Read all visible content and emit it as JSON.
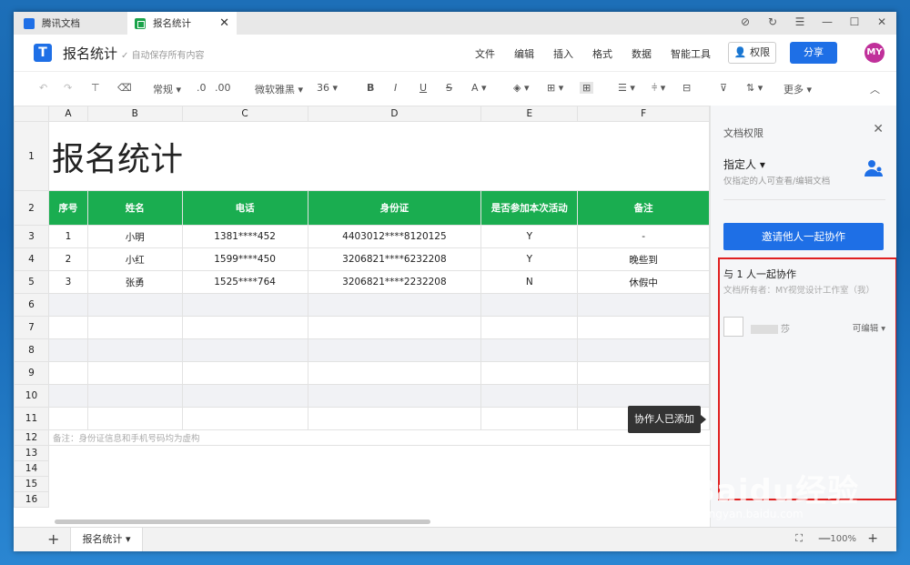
{
  "titlebar": {
    "tab1": "腾讯文档",
    "tab2": "报名统计",
    "tab_close": "✕",
    "controls": [
      "⊘",
      "↻",
      "☰",
      "—",
      "☐",
      "✕"
    ]
  },
  "header": {
    "logo": "T",
    "title": "报名统计",
    "autosave": "自动保存所有内容",
    "menu": [
      "文件",
      "编辑",
      "插入",
      "格式",
      "数据",
      "智能工具"
    ],
    "permission": "权限",
    "share": "分享",
    "avatar": "MY"
  },
  "toolbar": {
    "undo": "↶",
    "redo": "↷",
    "format_painter": "⊤",
    "clear": "⌫",
    "number_format": "常规 ▾",
    "dec_dec": ".0",
    "dec_inc": ".00",
    "font": "微软雅黑 ▾",
    "size": "36 ▾",
    "bold": "B",
    "italic": "I",
    "underline": "U",
    "strike": "S",
    "font_color": "A ▾",
    "fill": "◈ ▾",
    "border": "⊞ ▾",
    "merge": "⊞",
    "align": "☰ ▾",
    "valign": "⫩ ▾",
    "wrap": "⊟",
    "filter": "⊽",
    "sort": "⇅ ▾",
    "more": "更多 ▾",
    "collapse": "︿"
  },
  "sheet": {
    "columns": [
      "A",
      "B",
      "C",
      "D",
      "E",
      "F"
    ],
    "title": "报名统计",
    "headers": [
      "序号",
      "姓名",
      "电话",
      "身份证",
      "是否参加本次活动",
      "备注"
    ],
    "rows": [
      [
        "1",
        "小明",
        "1381****452",
        "4403012****8120125",
        "Y",
        "-"
      ],
      [
        "2",
        "小红",
        "1599****450",
        "3206821****6232208",
        "Y",
        "晚些到"
      ],
      [
        "3",
        "张勇",
        "1525****764",
        "3206821****2232208",
        "N",
        "休假中"
      ]
    ],
    "row_numbers": [
      "1",
      "2",
      "3",
      "4",
      "5",
      "6",
      "7",
      "8",
      "9",
      "10",
      "11",
      "12",
      "13",
      "14",
      "15",
      "16"
    ],
    "note": "备注：身份证信息和手机号码均为虚构"
  },
  "tooltip": "协作人已添加",
  "panel": {
    "title": "文档权限",
    "close": "✕",
    "designee": "指定人 ▾",
    "designee_desc": "仅指定的人可查看/编辑文档",
    "invite": "邀请他人一起协作",
    "collab": "与 1 人一起协作",
    "owner": "文档所有者：MY视觉设计工作室（我）",
    "user_name_suffix": "莎",
    "user_right": "可编辑 ▾"
  },
  "bottombar": {
    "add": "+",
    "sheet_tab": "报名统计 ▾",
    "zoom": "100%",
    "zoom_in": "+",
    "zoom_out": "—",
    "fit": "⛶"
  },
  "watermark": {
    "text": "Baidu经验",
    "url": "jingyan.baidu.com"
  },
  "colors": {
    "accent": "#1e6fe6",
    "header_green": "#1aad50",
    "highlight": "#e02020"
  }
}
